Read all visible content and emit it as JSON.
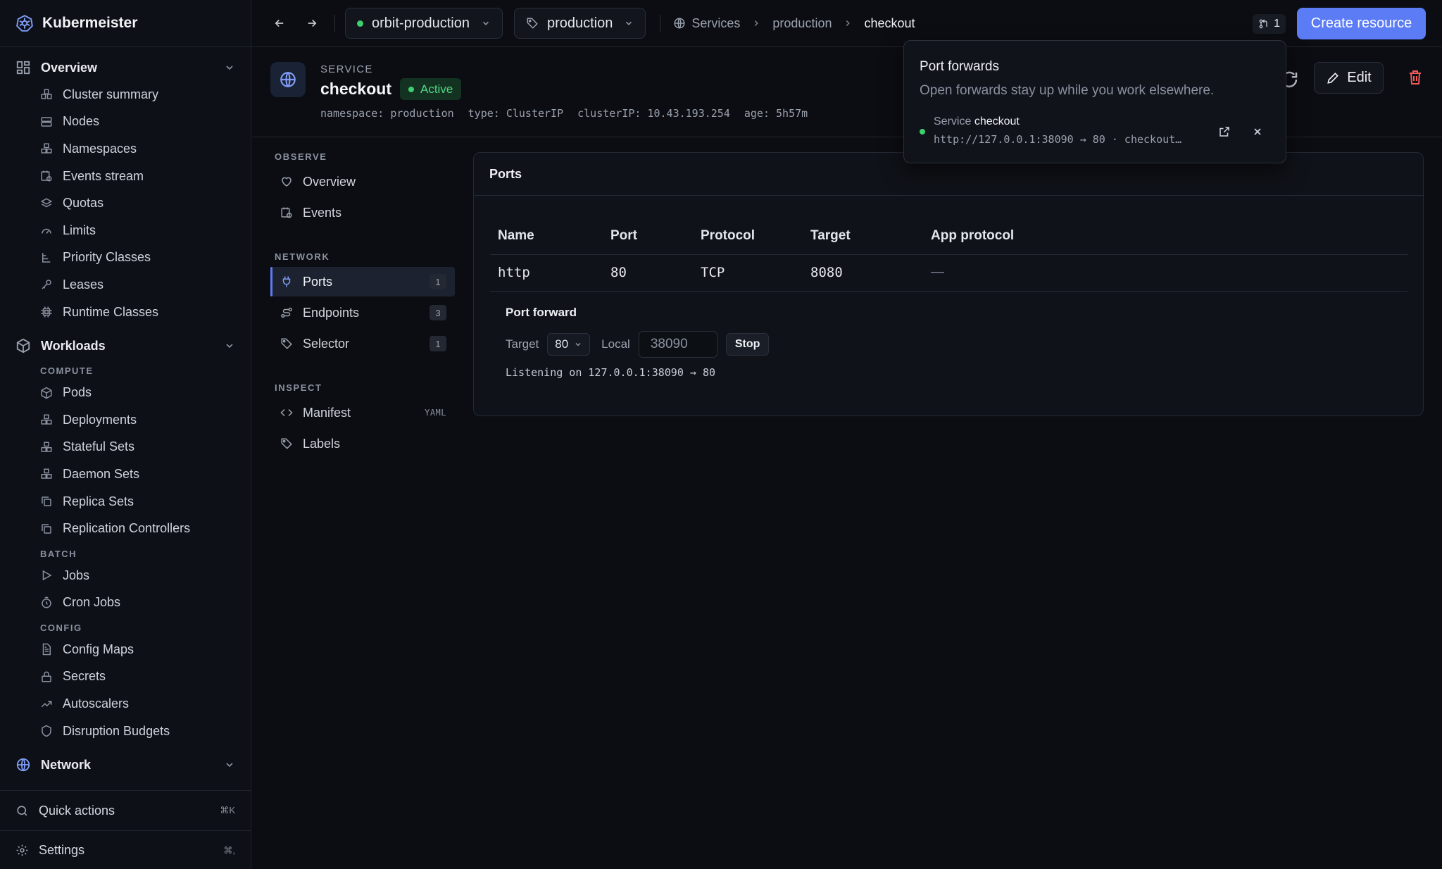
{
  "app": {
    "name": "Kubermeister"
  },
  "sidebar": {
    "groups": [
      {
        "label": "Overview",
        "items": [
          {
            "label": "Cluster summary",
            "icon": "cluster-icon"
          },
          {
            "label": "Nodes",
            "icon": "server-icon"
          },
          {
            "label": "Namespaces",
            "icon": "boxes-icon"
          },
          {
            "label": "Events stream",
            "icon": "calendar-clock-icon"
          },
          {
            "label": "Quotas",
            "icon": "layers-icon"
          },
          {
            "label": "Limits",
            "icon": "gauge-icon"
          },
          {
            "label": "Priority Classes",
            "icon": "priority-icon"
          },
          {
            "label": "Leases",
            "icon": "key-icon"
          },
          {
            "label": "Runtime Classes",
            "icon": "chip-icon"
          }
        ]
      },
      {
        "label": "Workloads",
        "sections": [
          {
            "label": "COMPUTE",
            "items": [
              {
                "label": "Pods",
                "icon": "cube-icon"
              },
              {
                "label": "Deployments",
                "icon": "boxes-icon"
              },
              {
                "label": "Stateful Sets",
                "icon": "boxes-icon"
              },
              {
                "label": "Daemon Sets",
                "icon": "boxes-icon"
              },
              {
                "label": "Replica Sets",
                "icon": "copy-icon"
              },
              {
                "label": "Replication Controllers",
                "icon": "copy-icon"
              }
            ]
          },
          {
            "label": "BATCH",
            "items": [
              {
                "label": "Jobs",
                "icon": "play-icon"
              },
              {
                "label": "Cron Jobs",
                "icon": "timer-icon"
              }
            ]
          },
          {
            "label": "CONFIG",
            "items": [
              {
                "label": "Config Maps",
                "icon": "file-text-icon"
              },
              {
                "label": "Secrets",
                "icon": "lock-icon"
              },
              {
                "label": "Autoscalers",
                "icon": "trend-up-icon"
              },
              {
                "label": "Disruption Budgets",
                "icon": "shield-icon"
              }
            ]
          }
        ]
      },
      {
        "label": "Network"
      }
    ],
    "quick_actions": {
      "label": "Quick actions",
      "shortcut": "⌘K"
    },
    "settings": {
      "label": "Settings",
      "shortcut": "⌘,"
    }
  },
  "topbar": {
    "cluster": "orbit-production",
    "namespace": "production",
    "breadcrumbs": [
      "Services",
      "production",
      "checkout"
    ],
    "port_forward_count": "1",
    "create_label": "Create resource",
    "accent": "#5b7cf5"
  },
  "resource": {
    "kind": "SERVICE",
    "name": "checkout",
    "status": "Active",
    "meta": [
      "namespace: production",
      "type: ClusterIP",
      "clusterIP: 10.43.193.254",
      "age: 5h57m"
    ],
    "edit_label": "Edit"
  },
  "subnav": {
    "observe_label": "OBSERVE",
    "observe": [
      {
        "label": "Overview",
        "icon": "heart-icon"
      },
      {
        "label": "Events",
        "icon": "calendar-clock-icon"
      }
    ],
    "network_label": "NETWORK",
    "network": [
      {
        "label": "Ports",
        "icon": "plug-icon",
        "count": "1"
      },
      {
        "label": "Endpoints",
        "icon": "route-icon",
        "count": "3"
      },
      {
        "label": "Selector",
        "icon": "tag-icon",
        "count": "1"
      }
    ],
    "inspect_label": "INSPECT",
    "inspect": [
      {
        "label": "Manifest",
        "icon": "code-icon",
        "badge": "YAML"
      },
      {
        "label": "Labels",
        "icon": "tag-icon"
      }
    ]
  },
  "ports": {
    "title": "Ports",
    "columns": [
      "Name",
      "Port",
      "Protocol",
      "Target",
      "App protocol"
    ],
    "rows": [
      [
        "http",
        "80",
        "TCP",
        "8080",
        "—"
      ]
    ],
    "forward": {
      "title": "Port forward",
      "target_label": "Target",
      "target_value": "80",
      "local_label": "Local",
      "local_placeholder": "38090",
      "stop_label": "Stop",
      "listening": "Listening on 127.0.0.1:38090 → 80"
    }
  },
  "popover": {
    "title": "Port forwards",
    "subtitle": "Open forwards stay up while you work elsewhere.",
    "items": [
      {
        "kind": "Service",
        "name": "checkout",
        "url": "http://127.0.0.1:38090 → 80 · checkout…"
      }
    ]
  }
}
